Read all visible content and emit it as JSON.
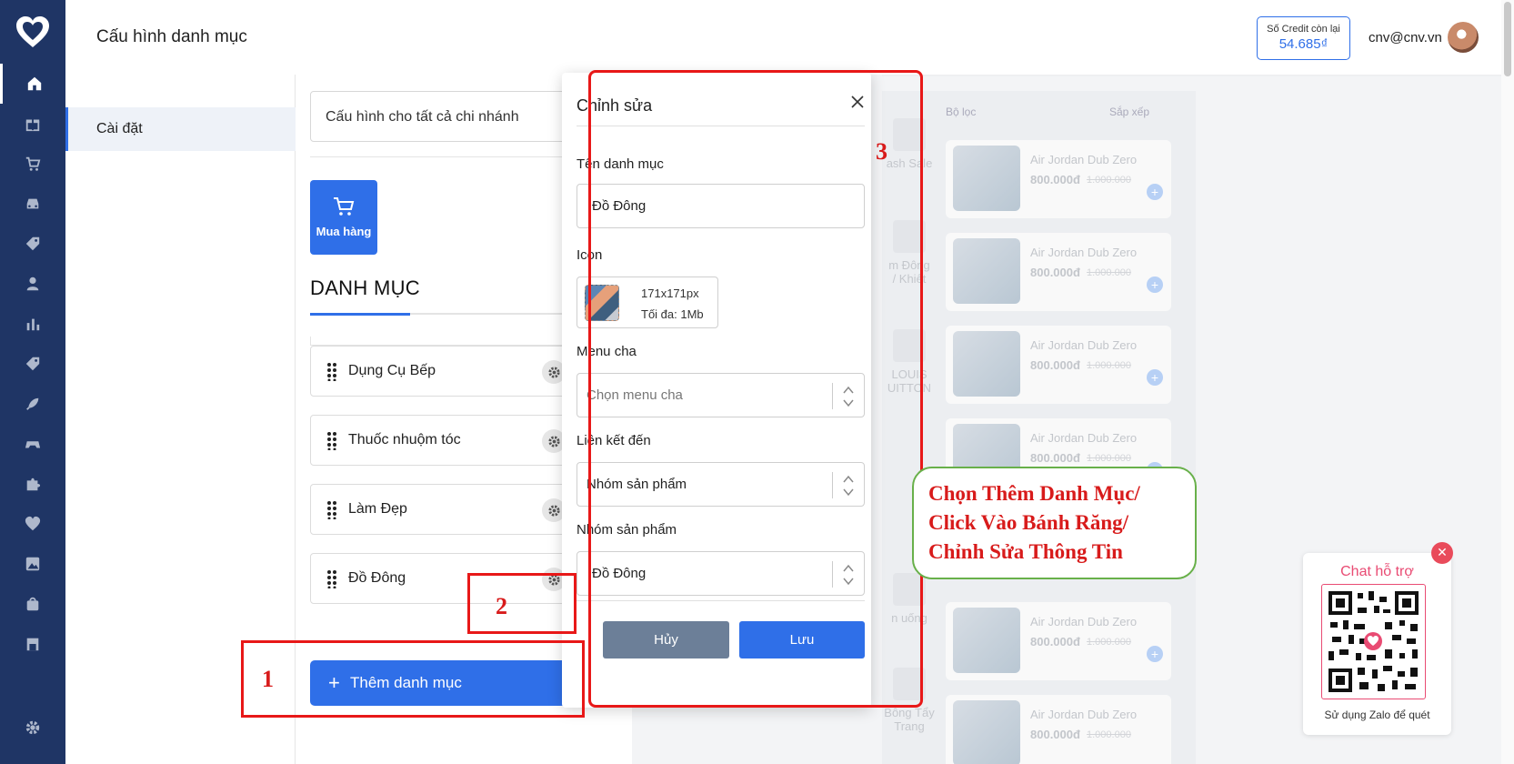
{
  "header": {
    "title": "Cấu hình danh mục",
    "credit_label": "Số Credit còn lại",
    "credit_value": "54.685₫",
    "user_email": "cnv@cnv.vn"
  },
  "sidebar": {
    "items": [
      "home-icon",
      "gift-icon",
      "cart-icon",
      "car-icon",
      "tag-icon",
      "user-icon",
      "chart-icon",
      "tag-icon",
      "rocket-icon",
      "gamepad-icon",
      "puzzle-icon",
      "heart-icon",
      "image-icon",
      "bag-icon",
      "store-icon",
      "settings-icon"
    ],
    "accent": "#1f3565"
  },
  "left_pane": {
    "settings_label": "Cài đặt"
  },
  "main": {
    "branch_select": "Cấu hình cho tất cả chi nhánh",
    "buy_tile_label": "Mua hàng",
    "section_title": "DANH MỤC",
    "categories": [
      "Dụng Cụ Bếp",
      "Thuốc nhuộm tóc",
      "Làm Đẹp",
      "Đồ Đông"
    ],
    "add_button": "Thêm danh mục"
  },
  "modal": {
    "title": "Chỉnh sửa",
    "name_label": "Tên danh mục",
    "name_value": "Đồ Đông",
    "icon_label": "Icon",
    "icon_size": "171x171px",
    "icon_max": "Tối đa: 1Mb",
    "parent_label": "Menu cha",
    "parent_placeholder": "Chọn menu cha",
    "link_label": "Liên kết đến",
    "link_value": "Nhóm sản phẩm",
    "group_label": "Nhóm sản phẩm",
    "group_value": "Đồ Đông",
    "cancel": "Hủy",
    "save": "Lưu"
  },
  "annotations": {
    "step1": "1",
    "step2": "2",
    "step3": "3",
    "callout_line1": "Chọn Thêm Danh Mục/",
    "callout_line2": "Click Vào Bánh Răng/",
    "callout_line3": "Chỉnh Sửa Thông Tin",
    "color": "#e81818"
  },
  "preview": {
    "filter": "Bộ lọc",
    "sort": "Sắp xếp",
    "side_categories": [
      "ash Sale",
      "m Đông\n/ Khiết",
      "LOUIS\nUITTON",
      "n uống",
      "Bông Tẩy\nTrang"
    ],
    "product_name": "Air Jordan Dub Zero",
    "price": "800.000đ",
    "old_price": "1.000.000"
  },
  "chat": {
    "title": "Chat hỗ trợ",
    "caption": "Sử dụng Zalo để quét"
  }
}
